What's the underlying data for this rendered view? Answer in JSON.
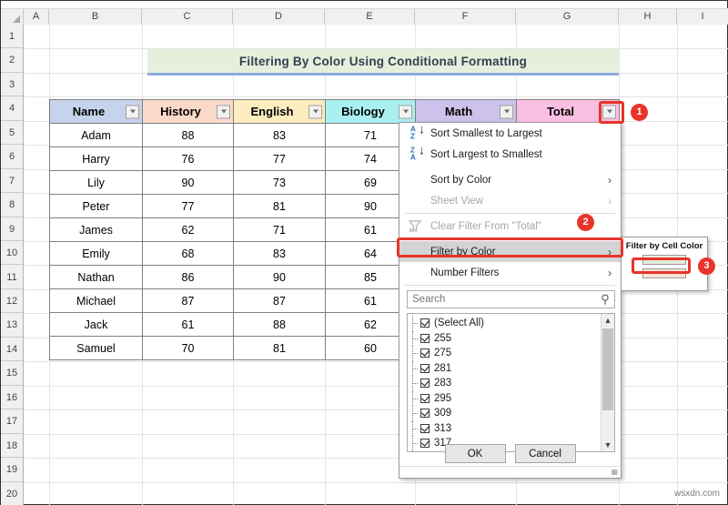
{
  "sheet": {
    "column_headers": [
      "A",
      "B",
      "C",
      "D",
      "E",
      "F",
      "G",
      "H",
      "I"
    ],
    "row_headers": [
      "1",
      "2",
      "3",
      "4",
      "5",
      "6",
      "7",
      "8",
      "9",
      "10",
      "11",
      "12",
      "13",
      "14",
      "15",
      "16",
      "17",
      "18",
      "19",
      "20"
    ]
  },
  "title": {
    "text": "Filtering By Color Using Conditional Formatting",
    "background": "#e5efdc",
    "underline_color": "#8ea9db"
  },
  "table": {
    "columns": [
      {
        "label": "Name",
        "color": "#c6d3ec"
      },
      {
        "label": "History",
        "color": "#fbd9c8"
      },
      {
        "label": "English",
        "color": "#fdecbf"
      },
      {
        "label": "Biology",
        "color": "#aaf0f0"
      },
      {
        "label": "Math",
        "color": "#ccc2eb"
      },
      {
        "label": "Total",
        "color": "#fbbfe3"
      }
    ],
    "rows": [
      {
        "name": "Adam",
        "history": "88",
        "english": "83",
        "biology": "71"
      },
      {
        "name": "Harry",
        "history": "76",
        "english": "77",
        "biology": "74"
      },
      {
        "name": "Lily",
        "history": "90",
        "english": "73",
        "biology": "69"
      },
      {
        "name": "Peter",
        "history": "77",
        "english": "81",
        "biology": "90"
      },
      {
        "name": "James",
        "history": "62",
        "english": "71",
        "biology": "61"
      },
      {
        "name": "Emily",
        "history": "68",
        "english": "83",
        "biology": "64"
      },
      {
        "name": "Nathan",
        "history": "86",
        "english": "90",
        "biology": "85"
      },
      {
        "name": "Michael",
        "history": "87",
        "english": "87",
        "biology": "61"
      },
      {
        "name": "Jack",
        "history": "61",
        "english": "88",
        "biology": "62"
      },
      {
        "name": "Samuel",
        "history": "70",
        "english": "81",
        "biology": "60"
      }
    ]
  },
  "filter_dropdown": {
    "menu_items": [
      {
        "label": "Sort Smallest to Largest",
        "icon": "sort-asc-icon",
        "submenu": false,
        "disabled": false,
        "selected": false
      },
      {
        "label": "Sort Largest to Smallest",
        "icon": "sort-desc-icon",
        "submenu": false,
        "disabled": false,
        "selected": false
      },
      {
        "label": "Sort by Color",
        "icon": "none",
        "submenu": true,
        "disabled": false,
        "selected": false
      },
      {
        "label": "Sheet View",
        "icon": "none",
        "submenu": true,
        "disabled": true,
        "selected": false
      },
      {
        "label": "Clear Filter From \"Total\"",
        "icon": "clear-filter-icon",
        "submenu": false,
        "disabled": true,
        "selected": false
      },
      {
        "label": "Filter by Color",
        "icon": "none",
        "submenu": true,
        "disabled": false,
        "selected": true
      },
      {
        "label": "Number Filters",
        "icon": "none",
        "submenu": true,
        "disabled": false,
        "selected": false
      }
    ],
    "search": {
      "placeholder": "Search",
      "value": "",
      "icon": "search-icon"
    },
    "list_items": [
      {
        "label": "(Select All)",
        "checked": true
      },
      {
        "label": "255",
        "checked": true
      },
      {
        "label": "275",
        "checked": true
      },
      {
        "label": "281",
        "checked": true
      },
      {
        "label": "283",
        "checked": true
      },
      {
        "label": "295",
        "checked": true
      },
      {
        "label": "309",
        "checked": true
      },
      {
        "label": "313",
        "checked": true
      },
      {
        "label": "317",
        "checked": true
      }
    ],
    "ok_label": "OK",
    "cancel_label": "Cancel"
  },
  "submenu": {
    "title": "Filter by Cell Color",
    "swatches": [
      {
        "color": "#e2efda",
        "name": "green-swatch"
      },
      {
        "color": "#fce4d6",
        "name": "peach-swatch"
      }
    ]
  },
  "callouts": [
    {
      "number": "1"
    },
    {
      "number": "2"
    },
    {
      "number": "3"
    }
  ],
  "watermark": "wsxdn.com"
}
